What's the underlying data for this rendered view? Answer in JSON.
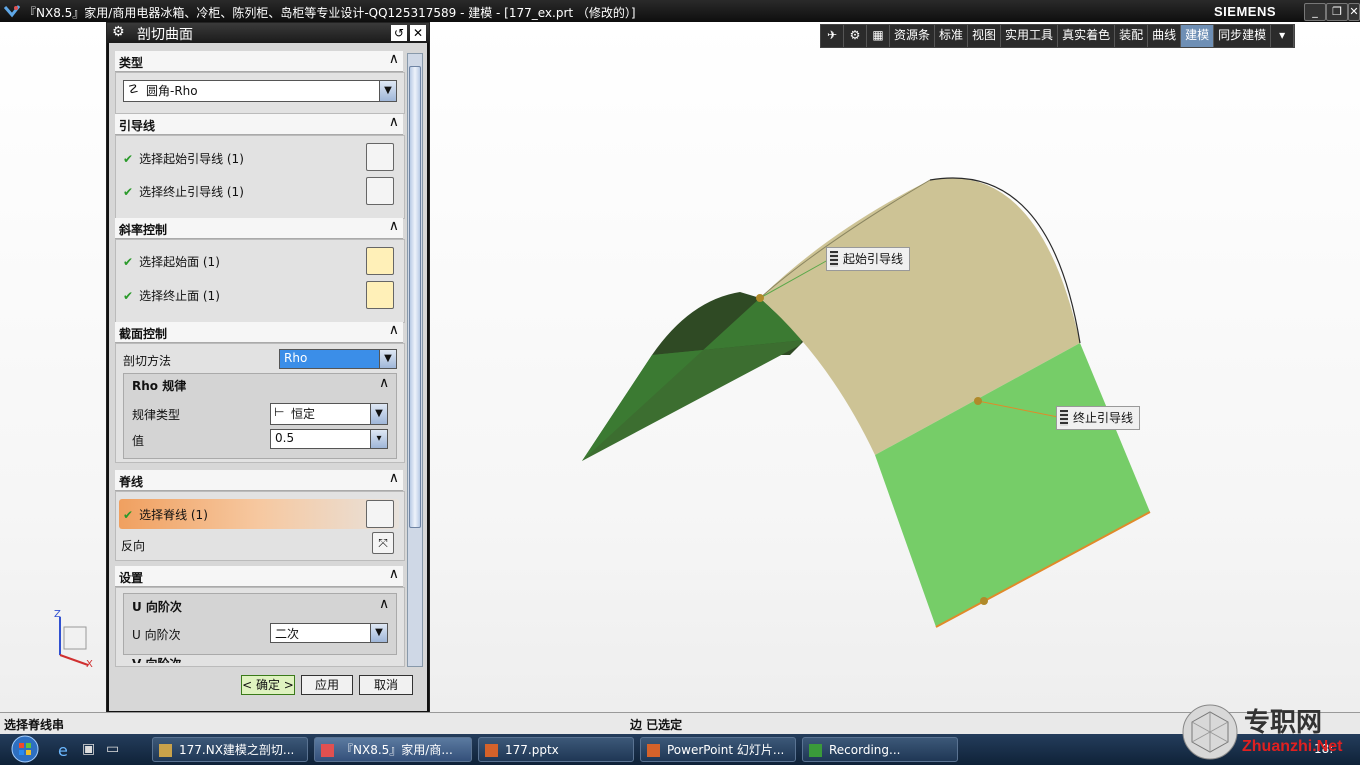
{
  "window": {
    "title": "『NX8.5』家用/商用电器冰箱、冷柜、陈列柜、岛柜等专业设计-QQ125317589 - 建模 - [177_ex.prt （修改的）]",
    "brand": "SIEMENS",
    "controls": [
      "_",
      "❐",
      "✕"
    ]
  },
  "toolbar": {
    "tabs": [
      "资源条",
      "标准",
      "视图",
      "实用工具",
      "真实着色",
      "装配",
      "曲线",
      "建模",
      "同步建模"
    ],
    "active_tab": "建模"
  },
  "dialog": {
    "title": "剖切曲面",
    "sections": {
      "type": {
        "label": "类型",
        "value": "圆角-Rho"
      },
      "guide": {
        "label": "引导线",
        "start": "选择起始引导线 (1)",
        "end": "选择终止引导线 (1)"
      },
      "slope": {
        "label": "斜率控制",
        "start": "选择起始面 (1)",
        "end": "选择终止面 (1)"
      },
      "section": {
        "label": "截面控制",
        "method_label": "剖切方法",
        "method_value": "Rho",
        "rho_law_label": "Rho 规律",
        "law_type_label": "规律类型",
        "law_type_value": "恒定",
        "value_label": "值",
        "value": "0.5"
      },
      "spine": {
        "label": "脊线",
        "select": "选择脊线 (1)",
        "reverse": "反向"
      },
      "settings": {
        "label": "设置",
        "u_order_header": "U 向阶次",
        "u_order_label": "U 向阶次",
        "u_order_value": "二次",
        "v_order_header": "V 向阶次"
      }
    },
    "buttons": {
      "ok": "< 确定 >",
      "apply": "应用",
      "cancel": "取消"
    }
  },
  "callouts": {
    "start_guide": "起始引导线",
    "end_guide": "终止引导线"
  },
  "status": {
    "left": "选择脊线串",
    "middle": "边 已选定"
  },
  "taskbar": {
    "tasks": [
      "177.NX建模之剖切...",
      "『NX8.5』家用/商...",
      "177.pptx",
      "PowerPoint 幻灯片...",
      "Recording..."
    ],
    "clock": "18:"
  },
  "triad": {
    "z": "Z",
    "x": "X"
  },
  "watermark": {
    "text": "专职网",
    "url": "Zhuanzhi.Net"
  },
  "colors": {
    "surface_tan": "#cdc395",
    "face_green": "#6ccd64",
    "face_dark": "#2f5a2a",
    "accent_orange": "#f0a060"
  }
}
